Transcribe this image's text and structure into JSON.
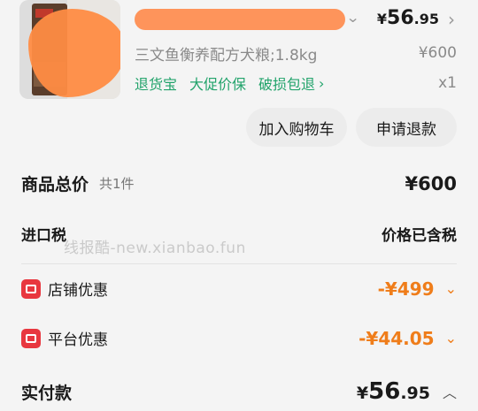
{
  "product": {
    "spec": "三文鱼衡养配方犬粮;1.8kg",
    "price_symbol": "¥",
    "price_int": "56",
    "price_dec": ".95",
    "original_price": "¥600",
    "quantity": "x1",
    "services": [
      "退货宝",
      "大促价保",
      "破损包退"
    ],
    "services_chevron": "›"
  },
  "actions": {
    "add_to_cart": "加入购物车",
    "refund": "申请退款"
  },
  "summary": {
    "total_label": "商品总价",
    "total_count": "共1件",
    "total_value": "¥600",
    "import_tax_label": "进口税",
    "import_tax_value": "价格已含税",
    "store_discount_label": "店铺优惠",
    "store_discount_value": "-¥499",
    "platform_discount_label": "平台优惠",
    "platform_discount_value": "-¥44.05",
    "paid_label": "实付款",
    "paid_symbol": "¥",
    "paid_int": "56",
    "paid_dec": ".95"
  },
  "watermark": "线报酷-new.xianbao.fun",
  "colors": {
    "accent_green": "#22a36b",
    "discount_orange": "#ef7d1a",
    "icon_red": "#e8373f"
  }
}
